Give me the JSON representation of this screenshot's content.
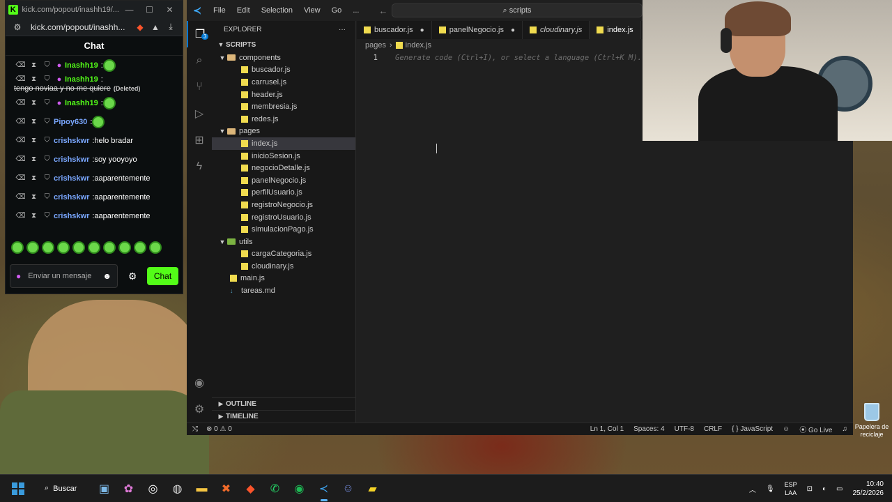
{
  "kick": {
    "window_title": "kick.com/popout/inashh19/...",
    "url": "kick.com/popout/inashh...",
    "chat_title": "Chat",
    "messages": [
      {
        "user": "Inashh19",
        "text": "",
        "emote": true,
        "color": "green",
        "mic": true,
        "deleted": false
      },
      {
        "user": "Inashh19",
        "text": "tengo noviaa y no me quiere",
        "emote": false,
        "color": "green",
        "mic": true,
        "deleted": true,
        "deleted_label": "(Deleted)"
      },
      {
        "user": "Inashh19",
        "text": "",
        "emote": true,
        "color": "green",
        "mic": true,
        "deleted": false
      },
      {
        "user": "Pipoy630",
        "text": "",
        "emote": true,
        "color": "blue",
        "mic": false,
        "deleted": false
      },
      {
        "user": "crishskwr",
        "text": "helo bradar",
        "emote": false,
        "color": "blue",
        "mic": false,
        "deleted": false
      },
      {
        "user": "crishskwr",
        "text": "soy yooyoyo",
        "emote": false,
        "color": "blue",
        "mic": false,
        "deleted": false
      },
      {
        "user": "crishskwr",
        "text": "aaparentemente",
        "emote": false,
        "color": "blue",
        "mic": false,
        "deleted": false
      },
      {
        "user": "crishskwr",
        "text": "aaparentemente",
        "emote": false,
        "color": "blue",
        "mic": false,
        "deleted": false
      },
      {
        "user": "crishskwr",
        "text": "aaparentemente",
        "emote": false,
        "color": "blue",
        "mic": false,
        "deleted": false
      }
    ],
    "input_placeholder": "Enviar un mensaje",
    "send_label": "Chat",
    "accent": "#53fc18"
  },
  "vscode": {
    "menu": [
      "File",
      "Edit",
      "Selection",
      "View",
      "Go",
      "..."
    ],
    "search_text": "scripts",
    "explorer_title": "EXPLORER",
    "root_folder": "SCRIPTS",
    "folders": {
      "components": {
        "name": "components",
        "files": [
          "buscador.js",
          "carrusel.js",
          "header.js",
          "membresia.js",
          "redes.js"
        ]
      },
      "pages": {
        "name": "pages",
        "files": [
          "index.js",
          "inicioSesion.js",
          "negocioDetalle.js",
          "panelNegocio.js",
          "perfilUsuario.js",
          "registroNegocio.js",
          "registroUsuario.js",
          "simulacionPago.js"
        ]
      },
      "utils": {
        "name": "utils",
        "files": [
          "cargaCategoria.js",
          "cloudinary.js"
        ]
      }
    },
    "root_files": [
      "main.js",
      "tareas.md"
    ],
    "outline": "OUTLINE",
    "timeline": "TIMELINE",
    "tabs": [
      {
        "label": "buscador.js",
        "modified": true
      },
      {
        "label": "panelNegocio.js",
        "modified": true
      },
      {
        "label": "cloudinary.js",
        "modified": false
      },
      {
        "label": "index.js",
        "modified": false
      }
    ],
    "breadcrumb": [
      "pages",
      "index.js"
    ],
    "line_number": "1",
    "hint": "Generate code (Ctrl+I), or select a language (Ctrl+K M).",
    "status": {
      "errors": "0",
      "warnings": "0",
      "position": "Ln 1, Col 1",
      "spaces": "Spaces: 4",
      "encoding": "UTF-8",
      "eol": "CRLF",
      "language": "JavaScript",
      "golive": "Go Live"
    }
  },
  "desktop": {
    "recycle_label": "Papelera de reciclaje"
  },
  "taskbar": {
    "search": "Buscar",
    "lang_top": "ESP",
    "lang_bottom": "LAA",
    "time": "10:40",
    "date": "25/2/2026"
  }
}
